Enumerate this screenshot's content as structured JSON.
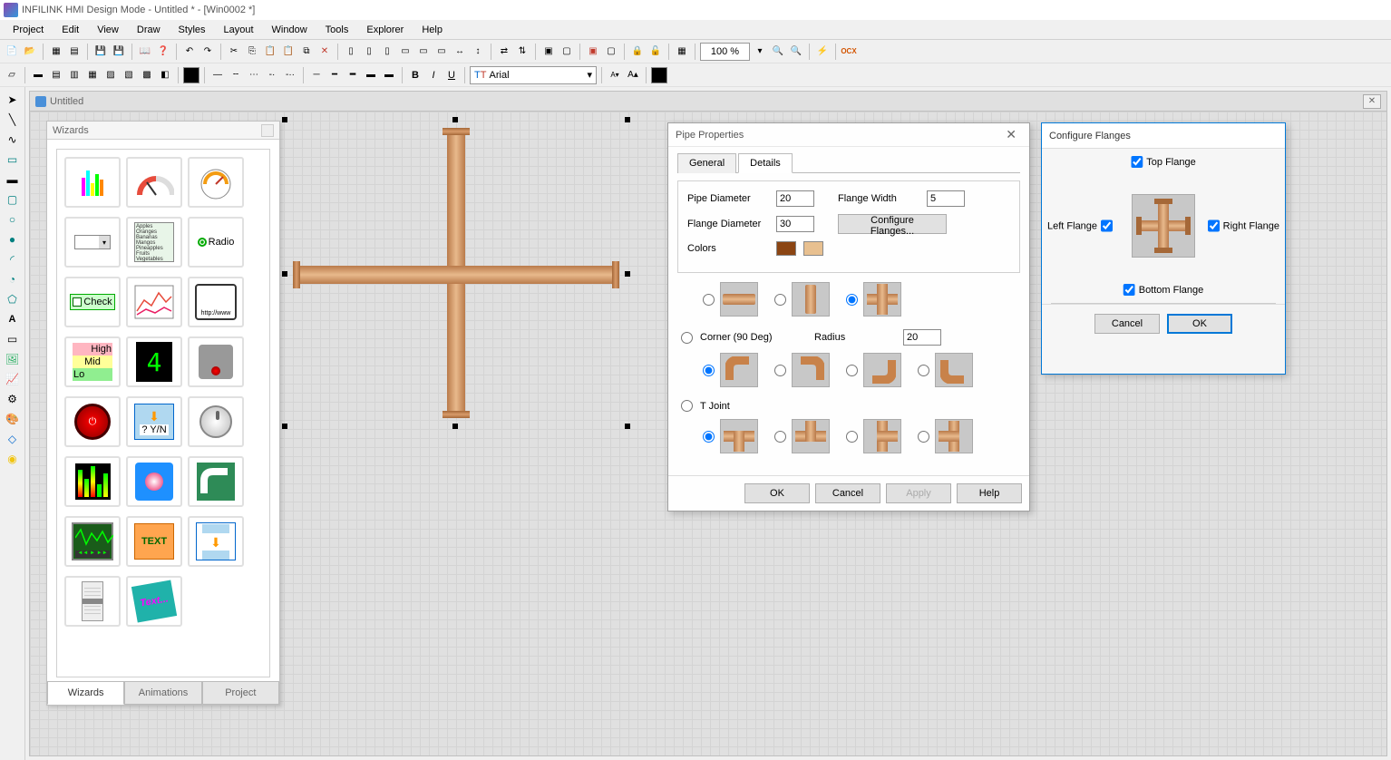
{
  "app_title": "INFILINK HMI Design Mode - Untitled * - [Win0002 *]",
  "menus": [
    "Project",
    "Edit",
    "View",
    "Draw",
    "Styles",
    "Layout",
    "Window",
    "Tools",
    "Explorer",
    "Help"
  ],
  "zoom": "100 %",
  "font_name": "Arial",
  "mdi_title": "Untitled",
  "wizards": {
    "title": "Wizards",
    "tabs": [
      "Wizards",
      "Animations",
      "Project"
    ]
  },
  "pipe_props": {
    "title": "Pipe Properties",
    "tabs": [
      "General",
      "Details"
    ],
    "pipe_diameter_label": "Pipe Diameter",
    "pipe_diameter": "20",
    "flange_width_label": "Flange Width",
    "flange_width": "5",
    "flange_diameter_label": "Flange Diameter",
    "flange_diameter": "30",
    "configure_flanges_btn": "Configure Flanges...",
    "colors_label": "Colors",
    "color1": "#8b4513",
    "color2": "#e8c090",
    "corner_label": "Corner (90 Deg)",
    "radius_label": "Radius",
    "radius": "20",
    "tjoint_label": "T Joint",
    "buttons": {
      "ok": "OK",
      "cancel": "Cancel",
      "apply": "Apply",
      "help": "Help"
    }
  },
  "flanges": {
    "title": "Configure Flanges",
    "top": "Top Flange",
    "bottom": "Bottom Flange",
    "left": "Left Flange",
    "right": "Right Flange",
    "ok": "OK",
    "cancel": "Cancel"
  },
  "wizard_items": [
    {
      "name": "bargraph",
      "bg": "#fff"
    },
    {
      "name": "gauge1",
      "bg": "#fff"
    },
    {
      "name": "gauge2",
      "bg": "#fff"
    },
    {
      "name": "combo",
      "bg": "#fff"
    },
    {
      "name": "listbox",
      "bg": "#dfd"
    },
    {
      "name": "radio",
      "bg": "#f5deb3",
      "text": "Radio"
    },
    {
      "name": "checkbox",
      "bg": "#90ee90",
      "text": "Check"
    },
    {
      "name": "trend",
      "bg": "#fff"
    },
    {
      "name": "webview",
      "bg": "#fff",
      "text": "http://www"
    },
    {
      "name": "hilo",
      "bg": "#ffb6c1"
    },
    {
      "name": "sevenseg",
      "bg": "#000"
    },
    {
      "name": "camera",
      "bg": "#888"
    },
    {
      "name": "powerbtn",
      "bg": "#8b0000"
    },
    {
      "name": "yesno",
      "bg": "#87ceeb",
      "text": "? Y/N"
    },
    {
      "name": "knob",
      "bg": "#ddd"
    },
    {
      "name": "equalizer",
      "bg": "#000"
    },
    {
      "name": "colorpick",
      "bg": "#1e90ff"
    },
    {
      "name": "pipe",
      "bg": "#2e8b57"
    },
    {
      "name": "oscope",
      "bg": "#228b22"
    },
    {
      "name": "textbtn",
      "bg": "#ffa500",
      "text": "TEXT"
    },
    {
      "name": "download",
      "bg": "#fff"
    },
    {
      "name": "slider",
      "bg": "#ddd"
    },
    {
      "name": "textfx",
      "bg": "#20b2aa",
      "text": "Text..."
    }
  ]
}
